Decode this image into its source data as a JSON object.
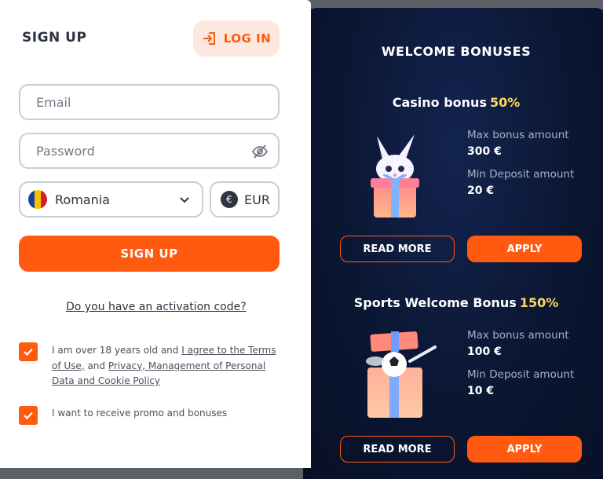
{
  "signup": {
    "title": "SIGN UP",
    "login_label": "LOG IN",
    "email_placeholder": "Email",
    "password_placeholder": "Password",
    "country": "Romania",
    "currency": "EUR",
    "currency_symbol": "€",
    "submit_label": "SIGN UP",
    "activation_link": "Do you have an activation code?",
    "terms": {
      "prefix": "I am over 18 years old and ",
      "link1": "I agree to the Terms of Use,",
      "middle": " and ",
      "link2": "Privacy, Management of Personal Data and Cookie Policy"
    },
    "promo_label": "I want to receive promo and bonuses"
  },
  "bonuses": {
    "title": "WELCOME BONUSES",
    "items": [
      {
        "name": "Casino bonus",
        "percent": "50%",
        "max_label": "Max bonus amount",
        "max_value": "300 €",
        "min_label": "Min Deposit amount",
        "min_value": "20 €",
        "read_more": "READ MORE",
        "apply": "APPLY"
      },
      {
        "name": "Sports Welcome Bonus",
        "percent": "150%",
        "max_label": "Max bonus amount",
        "max_value": "100 €",
        "min_label": "Min Deposit amount",
        "min_value": "10 €",
        "read_more": "READ MORE",
        "apply": "APPLY"
      }
    ]
  },
  "colors": {
    "accent": "#ff5a0f",
    "panel_dark": "#0b1633",
    "highlight": "#ffd95a"
  }
}
